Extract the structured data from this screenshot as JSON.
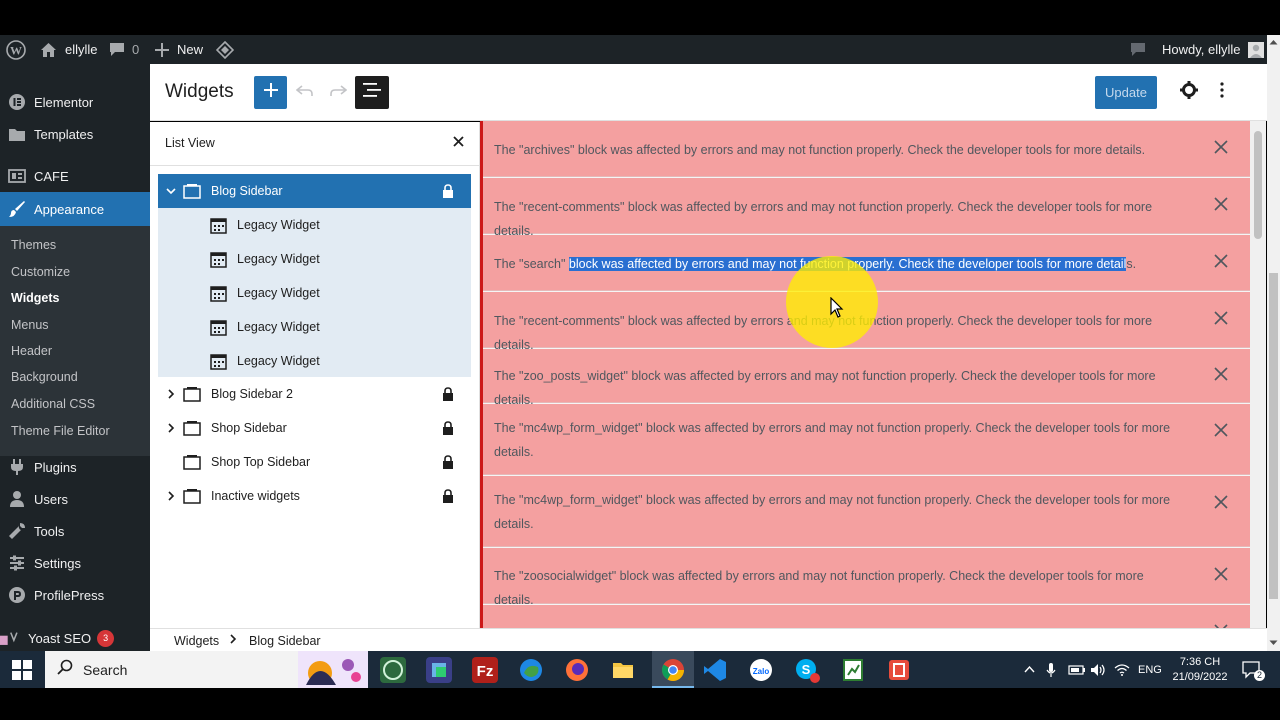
{
  "adminbar": {
    "site_name": "ellylle",
    "comments_count": "0",
    "new_label": "New",
    "howdy": "Howdy, ellylle"
  },
  "sidebar": {
    "items": [
      {
        "label": "Elementor",
        "icon": "elementor-icon"
      },
      {
        "label": "Templates",
        "icon": "folder-icon"
      },
      {
        "label": "CAFE",
        "icon": "cafe-icon"
      },
      {
        "label": "Appearance",
        "icon": "brush-icon"
      },
      {
        "label": "Plugins",
        "icon": "plugin-icon"
      },
      {
        "label": "Users",
        "icon": "user-icon"
      },
      {
        "label": "Tools",
        "icon": "wrench-icon"
      },
      {
        "label": "Settings",
        "icon": "settings-icon"
      },
      {
        "label": "ProfilePress",
        "icon": "profilepress-icon"
      },
      {
        "label": "Yoast SEO",
        "icon": "yoast-icon",
        "badge": "3"
      }
    ],
    "submenu": [
      "Themes",
      "Customize",
      "Widgets",
      "Menus",
      "Header",
      "Background",
      "Additional CSS",
      "Theme File Editor"
    ]
  },
  "header": {
    "title": "Widgets",
    "update_label": "Update"
  },
  "listview": {
    "title": "List View",
    "rows": [
      {
        "label": "Blog Sidebar",
        "expanded": true,
        "selected": true
      },
      {
        "label": "Legacy Widget"
      },
      {
        "label": "Legacy Widget"
      },
      {
        "label": "Legacy Widget"
      },
      {
        "label": "Legacy Widget"
      },
      {
        "label": "Legacy Widget"
      },
      {
        "label": "Blog Sidebar 2"
      },
      {
        "label": "Shop Sidebar"
      },
      {
        "label": "Shop Top Sidebar"
      },
      {
        "label": "Inactive widgets"
      }
    ]
  },
  "errors": [
    "The \"archives\" block was affected by errors and may not function properly. Check the developer tools for more details.",
    "The \"recent-comments\" block was affected by errors and may not function properly. Check the developer tools for more details.",
    {
      "before": "The \"search\" ",
      "highlighted": "block was affected by errors and may not function properly. Check the developer tools for more detail",
      "after": "s."
    },
    "The \"recent-comments\" block was affected by errors and may not function properly. Check the developer tools for more details.",
    "The \"zoo_posts_widget\" block was affected by errors and may not function properly. Check the developer tools for more details.",
    "The \"mc4wp_form_widget\" block was affected by errors and may not function properly. Check the developer tools for more details.",
    "The \"mc4wp_form_widget\" block was affected by errors and may not function properly. Check the developer tools for more details.",
    "The \"zoosocialwidget\" block was affected by errors and may not function properly. Check the developer tools for more details."
  ],
  "breadcrumb": [
    "Widgets",
    "Blog Sidebar"
  ],
  "taskbar": {
    "search_label": "Search",
    "language": "ENG",
    "time": "7:36 CH",
    "date": "21/09/2022",
    "notifications": "2"
  },
  "colors": {
    "admin_dark": "#1d2327",
    "accent": "#2271b1",
    "error_bg": "#f4a0a0",
    "error_edge": "#cc1818"
  }
}
